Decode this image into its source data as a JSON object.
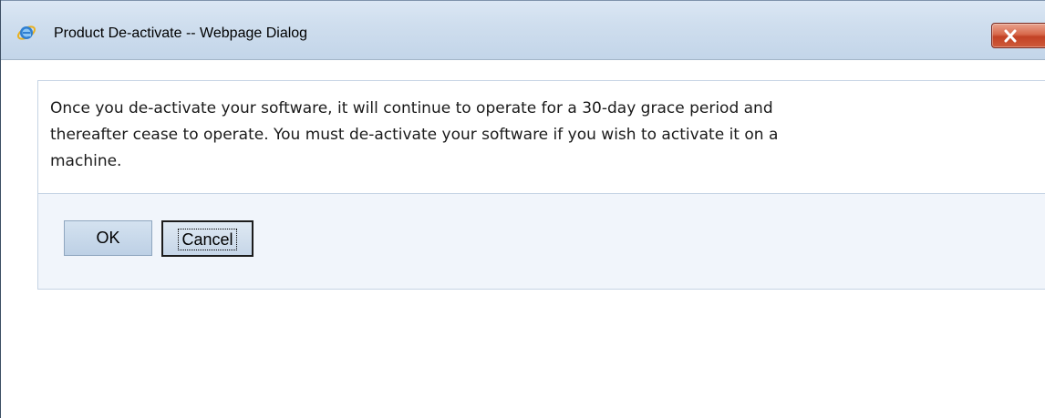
{
  "window": {
    "title": "Product De-activate -- Webpage Dialog",
    "icon": "internet-explorer-icon",
    "close_icon": "close-icon",
    "close_color": "#c24225"
  },
  "dialog": {
    "message": "Once you de-activate your software, it will continue to operate for a 30-day grace period and\nthereafter cease to operate. You must de-activate your software if you wish to activate it on a\nmachine.",
    "ok_label": "OK",
    "cancel_label": "Cancel",
    "focused_button": "Cancel"
  },
  "colors": {
    "titlebar": "#cfdeee",
    "panel_background": "#f1f5fb",
    "panel_border": "#c6d4e4"
  }
}
